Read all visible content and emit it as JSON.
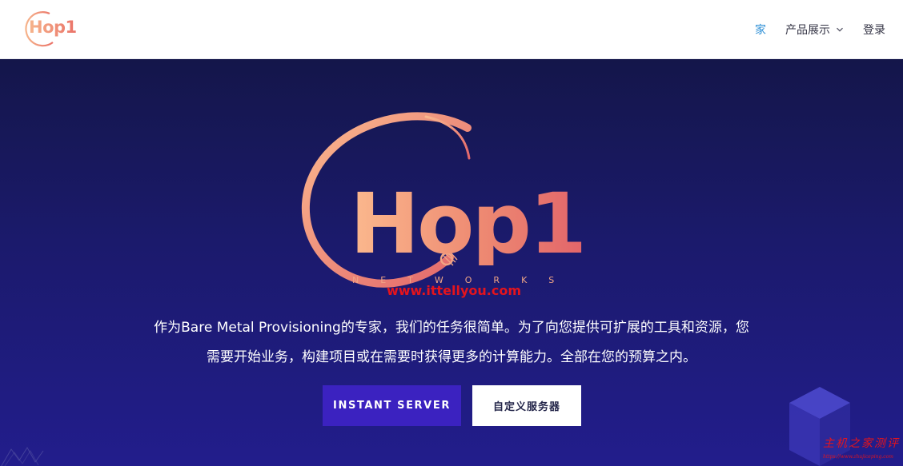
{
  "header": {
    "logo_text": "Hop1",
    "nav": [
      {
        "label": "家",
        "active": true
      },
      {
        "label": "产品展示",
        "has_dropdown": true
      },
      {
        "label": "登录"
      }
    ],
    "icons": {
      "dropdown": "chevron-down-icon"
    }
  },
  "hero": {
    "logo_word": "Hop1",
    "logo_subtitle": "NETWORKS",
    "watermark": "www.ittellyou.com",
    "tagline_line1": "作为Bare Metal Provisioning的专家，我们的任务很简单。为了向您提供可扩展的工具和资源，您",
    "tagline_line2": "需要开始业务，构建项目或在需要时获得更多的计算能力。全部在您的预算之内。",
    "primary_button": "INSTANT SERVER",
    "secondary_button": "自定义服务器"
  },
  "corner_watermark": {
    "title": "主机之家测评",
    "url": "https://www.zhujiceping.com"
  },
  "colors": {
    "hero_top": "#14164a",
    "hero_bottom": "#221d8c",
    "primary_button": "#3b22c0",
    "nav_active": "#2d8fd6",
    "logo_gradient_start": "#fbb98e",
    "logo_gradient_end": "#e2656a",
    "watermark": "#e4141d"
  }
}
